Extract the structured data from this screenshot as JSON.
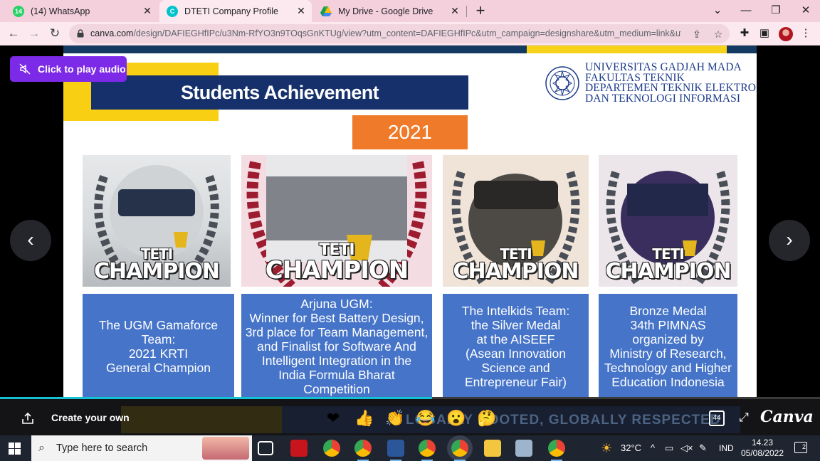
{
  "browser": {
    "tabs": [
      {
        "title": "(14) WhatsApp",
        "badge": "14",
        "favicon": "whatsapp-icon"
      },
      {
        "title": "DTETI Company Profile",
        "favicon": "canva-icon"
      },
      {
        "title": "My Drive - Google Drive",
        "favicon": "google-drive-icon"
      }
    ],
    "url_host": "canva.com",
    "url_path": "/design/DAFIEGHfIPc/u3Nm-RfYO3n9TOqsGnKTUg/view?utm_content=DAFIEGHfIPc&utm_campaign=designshare&utm_medium=link&ut..."
  },
  "slide": {
    "title": "Students Achievement",
    "year": "2021",
    "institution": [
      "UNIVERSITAS GADJAH MADA",
      "FAKULTAS TEKNIK",
      "DEPARTEMEN TEKNIK ELEKTRO",
      "DAN TEKNOLOGI INFORMASI"
    ],
    "badge_line1": "TETI",
    "badge_line2": "CHAMPION",
    "cards": [
      {
        "text": "The UGM Gamaforce Team:\n2021 KRTI\nGeneral Champion"
      },
      {
        "text": "Arjuna UGM:\nWinner for Best Battery Design,\n3rd place for Team Management,\nand Finalist for Software And\nIntelligent Integration in the\nIndia Formula Bharat\nCompetition"
      },
      {
        "text": "The Intelkids Team:\nthe Silver Medal\nat the AISEEF\n(Asean Innovation\nScience and\nEntrepreneur Fair)"
      },
      {
        "text": "Bronze Medal\n34th PIMNAS\norganized by\nMinistry of Research,\nTechnology and Higher\nEducation Indonesia"
      }
    ]
  },
  "player": {
    "audio_label": "Click to play audio",
    "create_label": "Create your own",
    "reactions": [
      "❤",
      "👍",
      "👏",
      "😂",
      "😮",
      "🤔"
    ],
    "page_count": "44",
    "brand": "Canva",
    "background_text": "LOCALLY ROOTED, GLOBALLY RESPECTED",
    "progress": 0.527
  },
  "taskbar": {
    "search_placeholder": "Type here to search",
    "weather": "32°C",
    "language": "IND",
    "time": "14.23",
    "date": "05/08/2022",
    "notifications": "2"
  },
  "colors": {
    "tabstrip": "#f4cfdc",
    "slide_title_bg": "#15306b",
    "year_bg": "#ee7a2a",
    "card_bg": "#4674c8",
    "accent_yellow": "#f9cf14",
    "canva_purple": "#7d2ae8"
  }
}
